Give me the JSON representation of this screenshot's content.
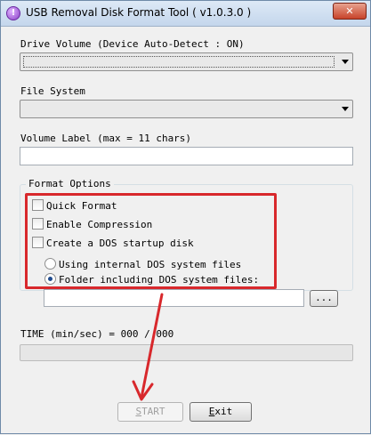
{
  "window": {
    "title": "USB Removal Disk Format Tool ( v1.0.3.0 )",
    "app_icon_glyph": "!"
  },
  "drive_volume": {
    "label": "Drive Volume  (Device Auto-Detect : ON)",
    "selected": ""
  },
  "file_system": {
    "label": "File System",
    "selected": ""
  },
  "volume_label": {
    "label": "Volume Label (max = 11 chars)",
    "value": ""
  },
  "format_options": {
    "title": "Format Options",
    "quick_format": "Quick Format",
    "enable_compression": "Enable Compression",
    "dos_startup": "Create a DOS startup disk",
    "internal_dos": "Using internal DOS system files",
    "folder_dos": "Folder including DOS system files:",
    "folder_path": "",
    "browse_label": "..."
  },
  "time": {
    "label": "TIME (min/sec) = 000 / 000"
  },
  "progress": {
    "value": 0
  },
  "buttons": {
    "start": "START",
    "exit": "Exit"
  },
  "colors": {
    "annotation": "#d8282c"
  }
}
